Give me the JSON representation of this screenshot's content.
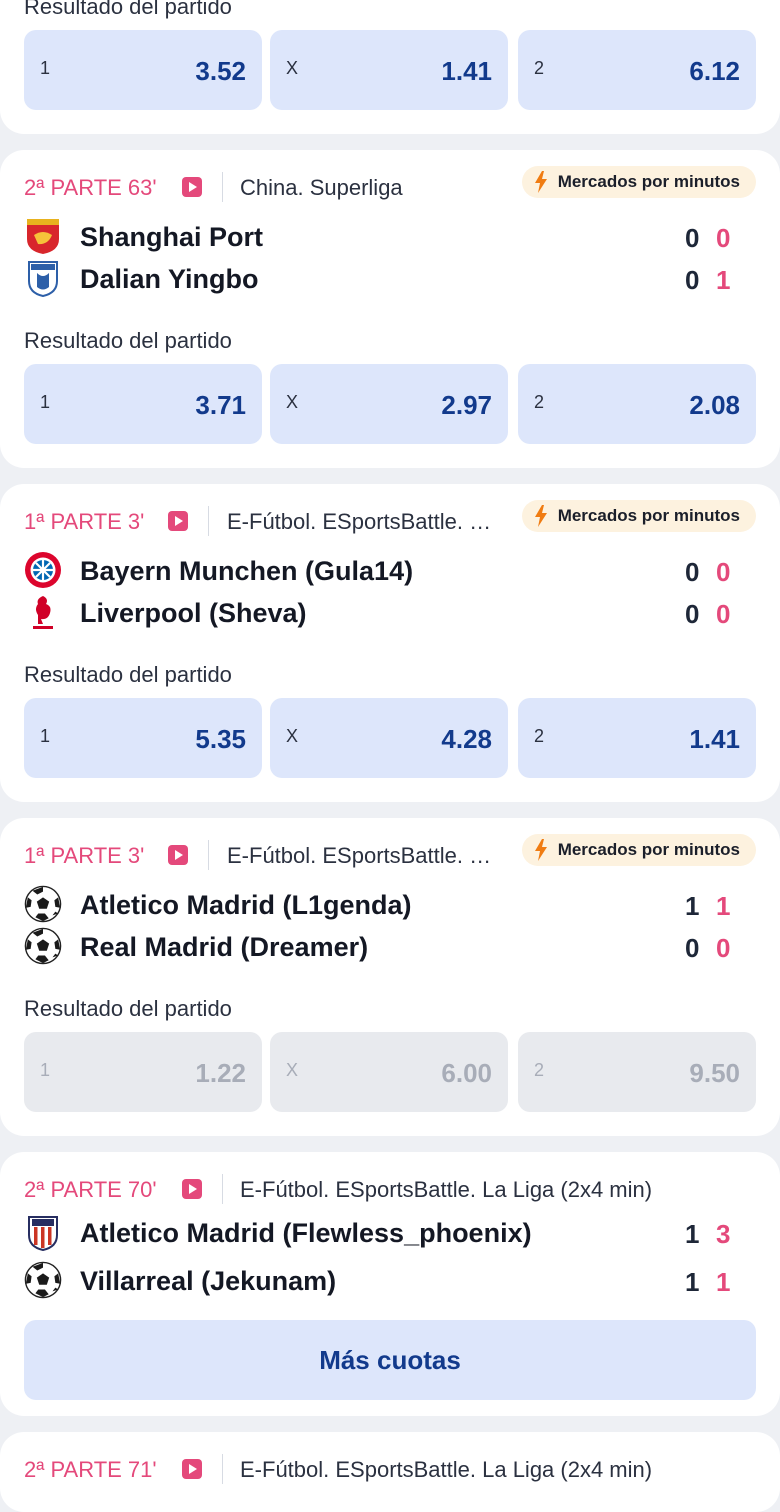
{
  "match0": {
    "market_label": "Resultado del partido",
    "odds": [
      {
        "label": "1",
        "value": "3.52"
      },
      {
        "label": "X",
        "value": "1.41"
      },
      {
        "label": "2",
        "value": "6.12"
      }
    ]
  },
  "match1": {
    "period": "2ª PARTE 63'",
    "league": "China. Superliga",
    "badge": "Mercados por minutos",
    "team1": {
      "name": "Shanghai Port",
      "score_total": "0",
      "score_period": "0"
    },
    "team2": {
      "name": "Dalian Yingbo",
      "score_total": "0",
      "score_period": "1"
    },
    "market_label": "Resultado del partido",
    "odds": [
      {
        "label": "1",
        "value": "3.71"
      },
      {
        "label": "X",
        "value": "2.97"
      },
      {
        "label": "2",
        "value": "2.08"
      }
    ]
  },
  "match2": {
    "period": "1ª PARTE 3'",
    "league": "E-Fútbol. ESportsBattle. …",
    "badge": "Mercados por minutos",
    "team1": {
      "name": "Bayern Munchen (Gula14)",
      "score_total": "0",
      "score_period": "0"
    },
    "team2": {
      "name": "Liverpool (Sheva)",
      "score_total": "0",
      "score_period": "0"
    },
    "market_label": "Resultado del partido",
    "odds": [
      {
        "label": "1",
        "value": "5.35"
      },
      {
        "label": "X",
        "value": "4.28"
      },
      {
        "label": "2",
        "value": "1.41"
      }
    ]
  },
  "match3": {
    "period": "1ª PARTE 3'",
    "league": "E-Fútbol. ESportsBattle. …",
    "badge": "Mercados por minutos",
    "team1": {
      "name": "Atletico Madrid (L1genda)",
      "score_total": "1",
      "score_period": "1"
    },
    "team2": {
      "name": "Real Madrid (Dreamer)",
      "score_total": "0",
      "score_period": "0"
    },
    "market_label": "Resultado del partido",
    "odds_disabled": true,
    "odds": [
      {
        "label": "1",
        "value": "1.22"
      },
      {
        "label": "X",
        "value": "6.00"
      },
      {
        "label": "2",
        "value": "9.50"
      }
    ]
  },
  "match4": {
    "period": "2ª PARTE 70'",
    "league": "E-Fútbol. ESportsBattle. La Liga (2x4 min)",
    "team1": {
      "name": "Atletico Madrid (Flewless_phoenix)",
      "score_total": "1",
      "score_period": "3"
    },
    "team2": {
      "name": "Villarreal (Jekunam)",
      "score_total": "1",
      "score_period": "1"
    },
    "more_button": "Más cuotas"
  },
  "match5": {
    "period": "2ª PARTE 71'",
    "league": "E-Fútbol. ESportsBattle. La Liga (2x4 min)"
  },
  "colors": {
    "live": "#e4497b",
    "odds_text": "#123a8c",
    "odds_bg": "#dde6fb",
    "badge_bg": "#fdf2df",
    "bolt": "#f07c12"
  },
  "icons": [
    "play-live-icon",
    "lightning-icon",
    "shanghai-port-crest",
    "dalian-yingbo-crest",
    "bayern-crest",
    "liverpool-crest",
    "soccer-ball-icon",
    "atletico-crest"
  ]
}
